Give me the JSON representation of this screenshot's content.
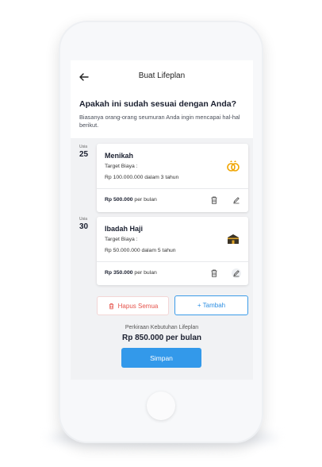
{
  "header": {
    "title": "Buat Lifeplan"
  },
  "intro": {
    "question": "Apakah ini sudah sesuai dengan Anda?",
    "subtitle": "Biasanya orang-orang seumuran Anda ingin mencapai hal-hal berikut."
  },
  "plans": [
    {
      "age_label": "Usia",
      "age": "25",
      "name": "Menikah",
      "target_label": "Target Biaya :",
      "target_value": "Rp 100.000.000 dalam 3 tahun",
      "monthly_amount": "Rp 500.000",
      "monthly_suffix": "per bulan",
      "icon": "wedding-rings-icon"
    },
    {
      "age_label": "Usia",
      "age": "30",
      "name": "Ibadah Haji",
      "target_label": "Target Biaya :",
      "target_value": "Rp 50.000.000 dalam 5 tahun",
      "monthly_amount": "Rp 350.000",
      "monthly_suffix": "per bulan",
      "icon": "kaaba-icon"
    }
  ],
  "actions": {
    "delete_all_label": "Hapus Semua",
    "add_label": "+ Tambah"
  },
  "summary": {
    "label": "Perkiraan Kebutuhan Lifeplan",
    "value": "Rp 850.000 per bulan"
  },
  "save_label": "Simpan",
  "colors": {
    "primary": "#3399ea",
    "danger": "#e5534b",
    "ring_gold": "#f0a500",
    "background_gray": "#f1f2f4"
  }
}
